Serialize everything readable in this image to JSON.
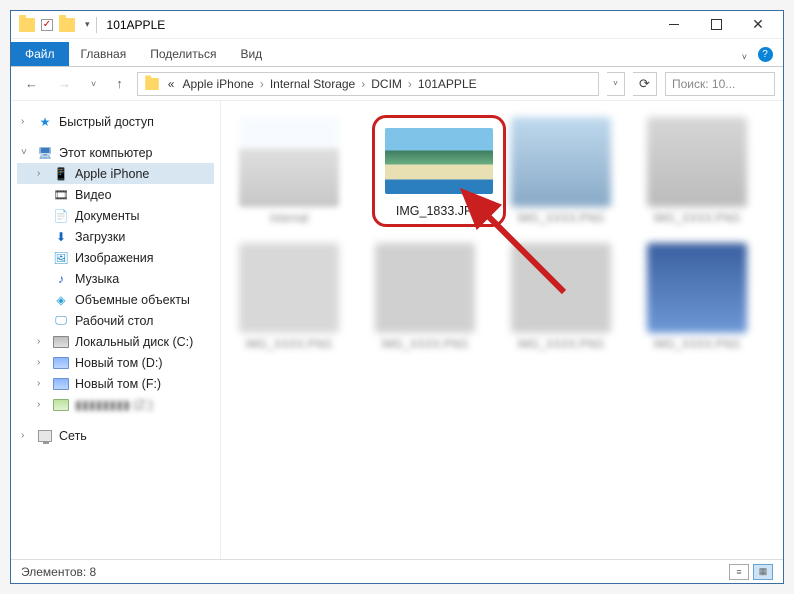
{
  "title_bar": {
    "title": "101APPLE"
  },
  "ribbon": {
    "file": "Файл",
    "tabs": [
      "Главная",
      "Поделиться",
      "Вид"
    ]
  },
  "address": {
    "segments": [
      "«",
      "Apple iPhone",
      "Internal Storage",
      "DCIM",
      "101APPLE"
    ]
  },
  "search": {
    "placeholder": "Поиск: 10..."
  },
  "nav_pane": {
    "quick_access": "Быстрый доступ",
    "this_pc": "Этот компьютер",
    "tree": [
      {
        "label": "Apple iPhone",
        "key": "apple-iphone",
        "selected": true
      },
      {
        "label": "Видео",
        "key": "video"
      },
      {
        "label": "Документы",
        "key": "documents"
      },
      {
        "label": "Загрузки",
        "key": "downloads"
      },
      {
        "label": "Изображения",
        "key": "pictures"
      },
      {
        "label": "Музыка",
        "key": "music"
      },
      {
        "label": "Объемные объекты",
        "key": "3dobjects"
      },
      {
        "label": "Рабочий стол",
        "key": "desktop"
      },
      {
        "label": "Локальный диск (C:)",
        "key": "drive-c"
      },
      {
        "label": "Новый том (D:)",
        "key": "drive-d"
      },
      {
        "label": "Новый том (F:)",
        "key": "drive-f"
      },
      {
        "label": "▮▮▮▮▮▮▮▮ (Z:)",
        "key": "drive-z"
      }
    ],
    "network": "Сеть"
  },
  "content": {
    "highlighted_file": "IMG_1833.JPG",
    "blurred_items": [
      "item",
      "item",
      "item",
      "item",
      "item",
      "item",
      "item"
    ]
  },
  "statusbar": {
    "count_label": "Элементов: 8"
  }
}
